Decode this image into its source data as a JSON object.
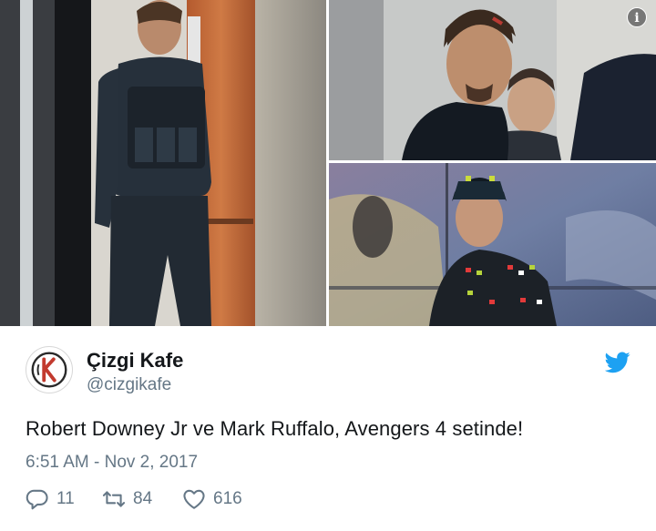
{
  "tweet": {
    "display_name": "Çizgi Kafe",
    "handle": "@cizgikafe",
    "text": "Robert Downey Jr ve Mark Ruffalo, Avengers 4 setinde!",
    "timestamp": "6:51 AM - Nov 2, 2017",
    "reply_count": "11",
    "retweet_count": "84",
    "like_count": "616",
    "info_glyph": "i"
  },
  "colors": {
    "twitter_blue": "#1da1f2",
    "meta_gray": "#657786",
    "text": "#14171a"
  },
  "icons": [
    "info-icon",
    "twitter-bird-icon",
    "reply-icon",
    "retweet-icon",
    "like-icon"
  ]
}
